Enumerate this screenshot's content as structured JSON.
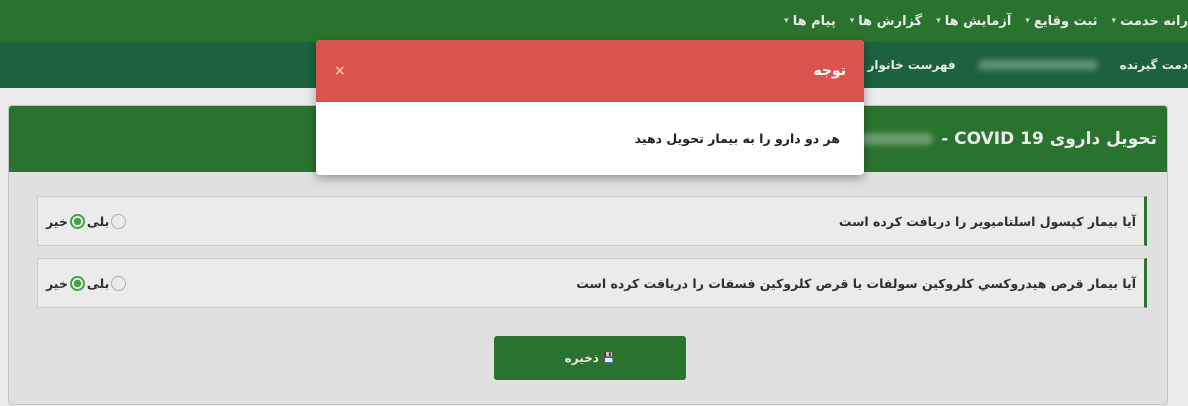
{
  "topnav": {
    "items": [
      {
        "label": "رانه خدمت"
      },
      {
        "label": "ثبت وقایع"
      },
      {
        "label": "آزمایش ها"
      },
      {
        "label": "گزارش ها"
      },
      {
        "label": "پیام ها"
      }
    ],
    "caret": "▾"
  },
  "subnav": {
    "crumb1": "دمت گیرنده",
    "crumb2": "فهرست خانوار"
  },
  "card": {
    "title": "تحویل داروی COVID 19 -",
    "questions": [
      {
        "text": "آیا بیمار کپسول اسلتامیویر را دریافت کرده است",
        "yes": "بلی",
        "no": "خیر",
        "selected": "no"
      },
      {
        "text": "آیا بیمار قرص هیدروکسي کلروکین سولفات یا قرص کلروکین فسفات را دریافت کرده است",
        "yes": "بلی",
        "no": "خیر",
        "selected": "no"
      }
    ],
    "save_label": "ذخیره",
    "save_icon": "💾"
  },
  "modal": {
    "title": "توجه",
    "close": "×",
    "message": "هر دو دارو را به بیمار تحویل دهید"
  },
  "colors": {
    "primary": "#2e7d32",
    "secondary": "#1f6b44",
    "danger": "#d9534f"
  }
}
